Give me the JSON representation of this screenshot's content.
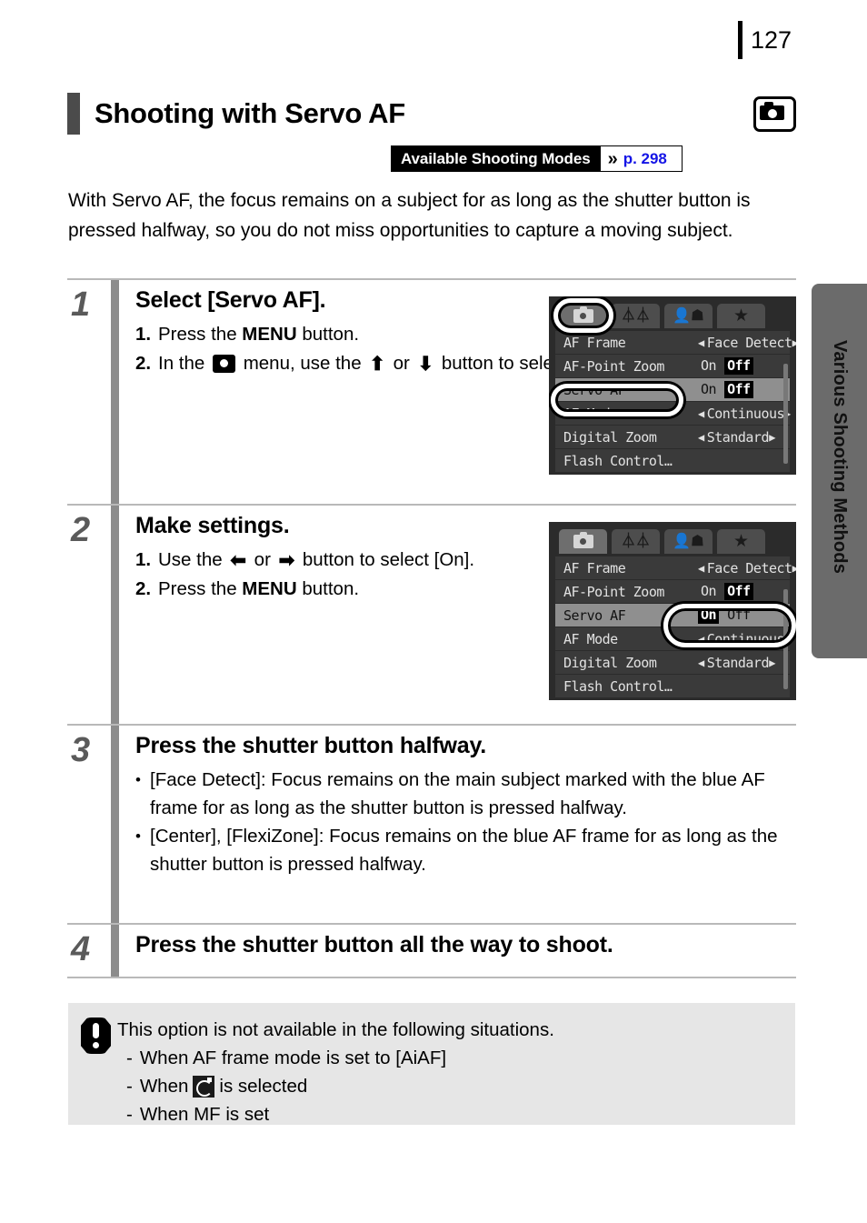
{
  "folio": {
    "page_number": "127"
  },
  "header": {
    "title": "Shooting with Servo AF",
    "camera_icon": "camera-icon",
    "modes_badge": {
      "label": "Available Shooting Modes",
      "chevron": "»",
      "page_ref": "p. 298",
      "link_color": "#1414e6"
    }
  },
  "intro": "With Servo AF, the focus remains on a subject for as long as the shutter button is pressed halfway, so you do not miss opportunities to capture a moving subject.",
  "steps": [
    {
      "number": "1",
      "heading": "Select [Servo AF].",
      "substeps": [
        {
          "marker": "1.",
          "pre": "Press the ",
          "key": "MENU",
          "post": " button."
        },
        {
          "marker": "2.",
          "pre": "In the ",
          "icon": "camera-menu-icon",
          "mid": " menu, use the ",
          "up": "⬆",
          "or": " or ",
          "down": "⬇",
          "post": " button to select [Servo AF]."
        }
      ]
    },
    {
      "number": "2",
      "heading": "Make settings.",
      "substeps": [
        {
          "marker": "1.",
          "pre": "Use the ",
          "left": "⬅",
          "or": " or ",
          "right": "➡",
          "post": " button to select [On]."
        },
        {
          "marker": "2.",
          "pre": "Press the ",
          "key": "MENU",
          "post": " button."
        }
      ]
    },
    {
      "number": "3",
      "heading": "Press the shutter button halfway.",
      "bullets": [
        "[Face Detect]: Focus remains on the main subject marked with the blue AF frame for as long as the shutter button is pressed halfway.",
        "[Center], [FlexiZone]: Focus remains on the blue AF frame for as long as the shutter button is pressed halfway."
      ]
    },
    {
      "number": "4",
      "heading": "Press the shutter button all the way to shoot.",
      "bullets": []
    }
  ],
  "lcd_screens": [
    {
      "id": "lcd-1",
      "tabs": [
        "camera-tab",
        "tools-tab",
        "my-camera-tab",
        "star-tab"
      ],
      "active_tab": 0,
      "rows": [
        {
          "name": "AF Frame",
          "value": "Face Detect",
          "type": "carousel",
          "selected": false
        },
        {
          "name": "AF-Point Zoom",
          "value": "",
          "type": "onoff",
          "on": "On",
          "off": "Off",
          "chosen": "Off",
          "selected": false
        },
        {
          "name": "Servo AF",
          "value": "",
          "type": "onoff",
          "on": "On",
          "off": "Off",
          "chosen": "Off",
          "selected": true
        },
        {
          "name": "AF Mode",
          "value": "Continuous",
          "type": "carousel",
          "selected": false
        },
        {
          "name": "Digital Zoom",
          "value": "Standard",
          "type": "carousel",
          "selected": false
        },
        {
          "name": "Flash Control…",
          "value": "",
          "type": "plain",
          "selected": false
        }
      ],
      "highlight": "servo-af-row-and-camera-tab"
    },
    {
      "id": "lcd-2",
      "tabs": [
        "camera-tab",
        "tools-tab",
        "my-camera-tab",
        "star-tab"
      ],
      "active_tab": 0,
      "rows": [
        {
          "name": "AF Frame",
          "value": "Face Detect",
          "type": "carousel",
          "selected": false
        },
        {
          "name": "AF-Point Zoom",
          "value": "",
          "type": "onoff",
          "on": "On",
          "off": "Off",
          "chosen": "Off",
          "selected": false
        },
        {
          "name": "Servo AF",
          "value": "",
          "type": "onoff",
          "on": "On",
          "off": "Off",
          "chosen": "On",
          "selected": true
        },
        {
          "name": "AF Mode",
          "value": "Continuous",
          "type": "carousel",
          "selected": false
        },
        {
          "name": "Digital Zoom",
          "value": "Standard",
          "type": "carousel",
          "selected": false
        },
        {
          "name": "Flash Control…",
          "value": "",
          "type": "plain",
          "selected": false
        }
      ],
      "highlight": "servo-af-onoff-value"
    }
  ],
  "note": {
    "icon": "exclamation-icon",
    "lead": "This option is not available in the following situations.",
    "items": [
      {
        "dash": "-",
        "pre": "When AF frame mode is set to [AiAF]",
        "icon": null,
        "post": ""
      },
      {
        "dash": "-",
        "pre": "When ",
        "icon": "self-timer-icon",
        "post": " is selected"
      },
      {
        "dash": "-",
        "pre": "When MF is set",
        "icon": null,
        "post": ""
      }
    ]
  },
  "side_tab": {
    "label": "Various Shooting Methods"
  }
}
